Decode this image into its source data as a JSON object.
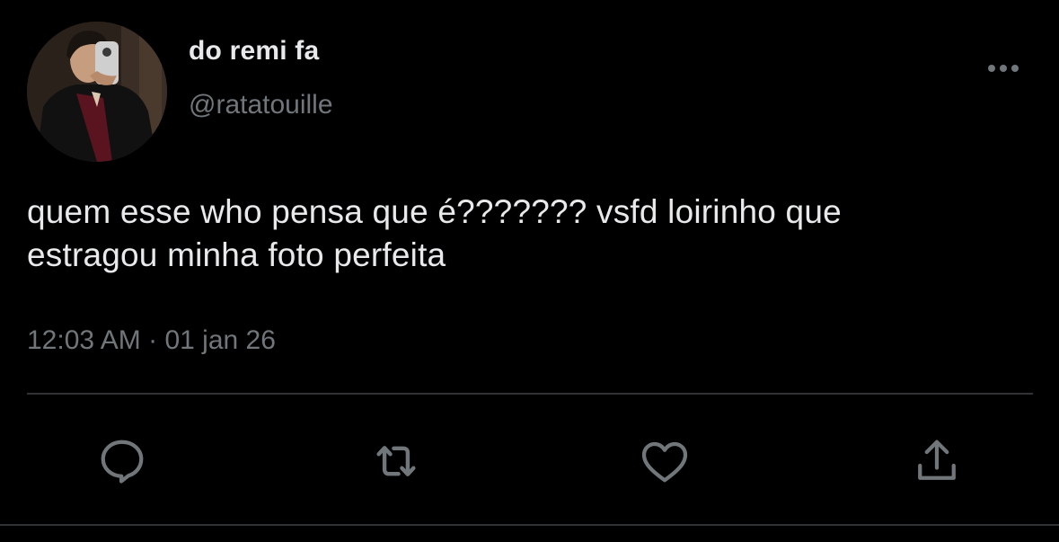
{
  "author": {
    "display_name": "do remi fa",
    "handle": "@ratatouille"
  },
  "tweet": {
    "text_line1": "quem esse who pensa que é??????? vsfd loirinho que",
    "text_line2": "estragou minha foto perfeita",
    "time": "12:03 AM",
    "separator": "·",
    "date": "01 jan 26"
  },
  "icons": {
    "more": "more-dots-icon",
    "reply": "reply-bubble-icon",
    "retweet": "retweet-icon",
    "like": "heart-icon",
    "share": "share-upload-icon"
  },
  "colors": {
    "background": "#000000",
    "primary_text": "#e7e9ea",
    "secondary_text": "#71767b",
    "divider": "#2f3336",
    "icon": "#71767b"
  }
}
